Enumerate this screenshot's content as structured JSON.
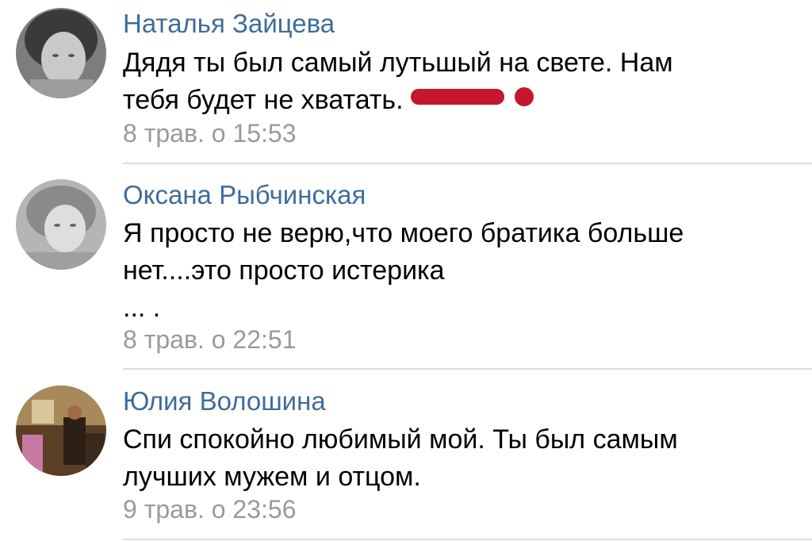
{
  "comments": [
    {
      "author": "Наталья Зайцева",
      "text": "Дядя ты был самый лутьшый на свете. Нам\nтебя будет не хватать. ",
      "time": "8 трав. о 15:53",
      "redaction_color": "#c4162d"
    },
    {
      "author": "Оксана Рыбчинская",
      "text": "Я просто не верю,что моего братика больше\nнет....это просто истерика\n... .",
      "time": "8 трав. о 22:51"
    },
    {
      "author": "Юлия Волошина",
      "text": "Спи спокойно любимый мой. Ты был самым\nлучших мужем и отцом.",
      "time": "9 трав. о 23:56"
    }
  ],
  "colors": {
    "author": "#3f6c9b",
    "meta": "#9a9a9a",
    "divider": "#dcdcdc"
  }
}
